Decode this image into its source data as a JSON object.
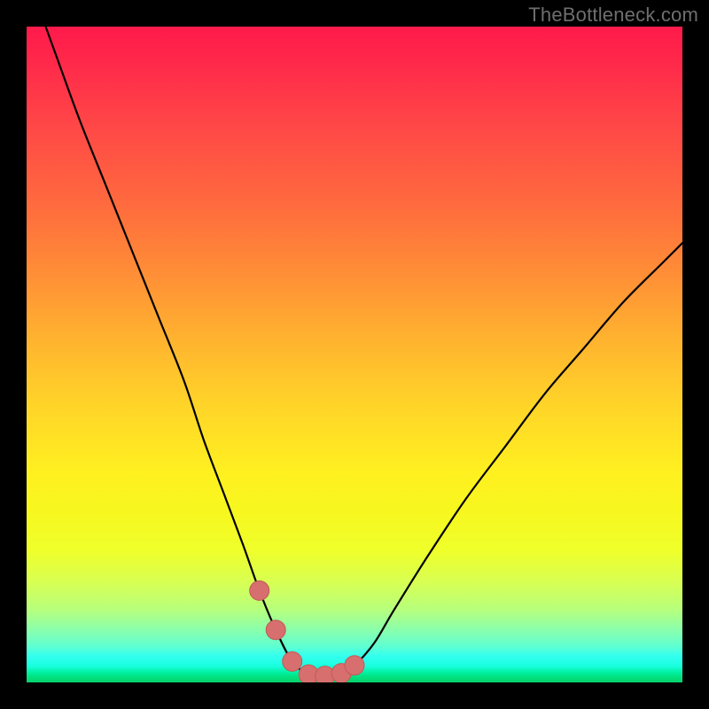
{
  "watermark": "TheBottleneck.com",
  "plot_colors": {
    "frame": "#000000",
    "curve_stroke": "#000000",
    "marker_fill": "#d66f6e",
    "marker_stroke": "#c25a59",
    "gradient_top": "#ff1a4b",
    "gradient_bottom": "#05d36b"
  },
  "chart_data": {
    "type": "line",
    "title": "",
    "xlabel": "",
    "ylabel": "",
    "xlim": [
      0,
      100
    ],
    "ylim": [
      0,
      100
    ],
    "grid": false,
    "legend": false,
    "series": [
      {
        "name": "bottleneck-curve",
        "x": [
          0,
          4,
          8,
          12,
          16,
          20,
          24,
          27,
          30,
          33,
          35.5,
          38,
          40.5,
          43,
          45.5,
          48,
          50,
          53,
          56,
          61,
          67,
          73,
          79,
          85,
          91,
          97,
          100
        ],
        "y": [
          108,
          97,
          86,
          76,
          66,
          56,
          46,
          37,
          29,
          21,
          14,
          8,
          3.2,
          1.2,
          1.0,
          1.4,
          2.6,
          6,
          11,
          19,
          28,
          36,
          44,
          51,
          58,
          64,
          67
        ]
      },
      {
        "name": "markers",
        "x": [
          35.5,
          38,
          40.5,
          43,
          45.5,
          48,
          50
        ],
        "y": [
          14,
          8,
          3.2,
          1.2,
          1.0,
          1.4,
          2.6
        ]
      }
    ]
  }
}
